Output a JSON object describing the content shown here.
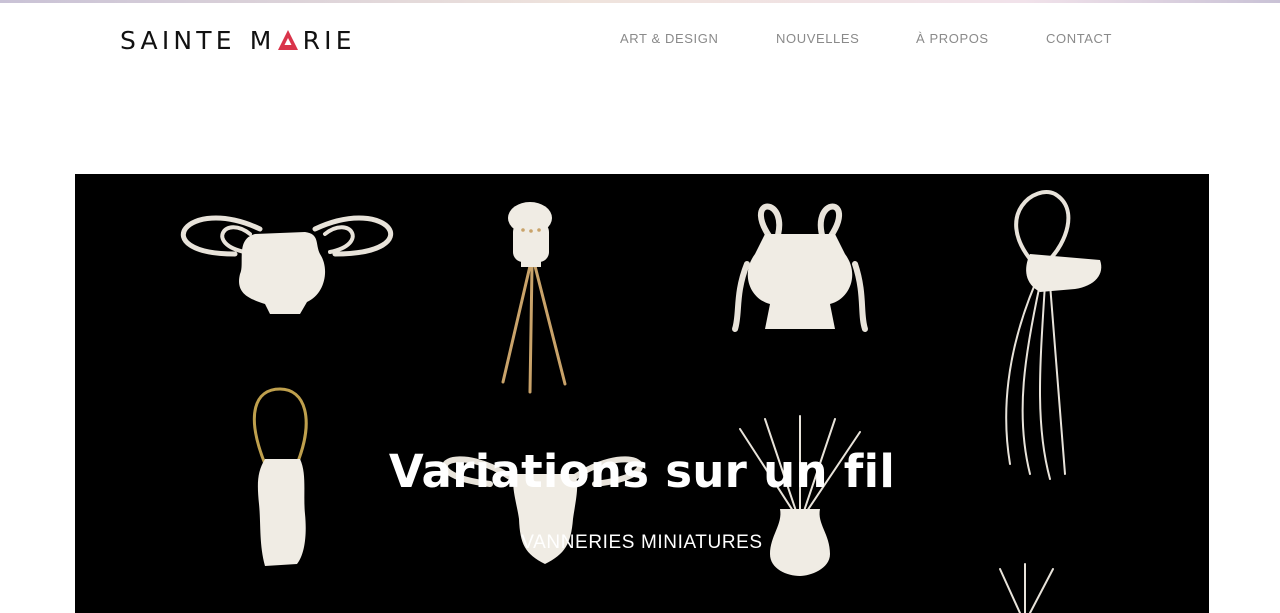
{
  "brand": {
    "word1": "SAINTE",
    "word2_before": "M",
    "word2_after": "RIE",
    "accent_color": "#d9344a"
  },
  "nav": {
    "items": [
      {
        "label": "ART & DESIGN"
      },
      {
        "label": "NOUVELLES"
      },
      {
        "label": "À PROPOS"
      },
      {
        "label": "CONTACT"
      }
    ]
  },
  "hero": {
    "title": "Variations sur un fil",
    "subtitle": "VANNERIES MINIATURES",
    "background_color": "#000000"
  }
}
